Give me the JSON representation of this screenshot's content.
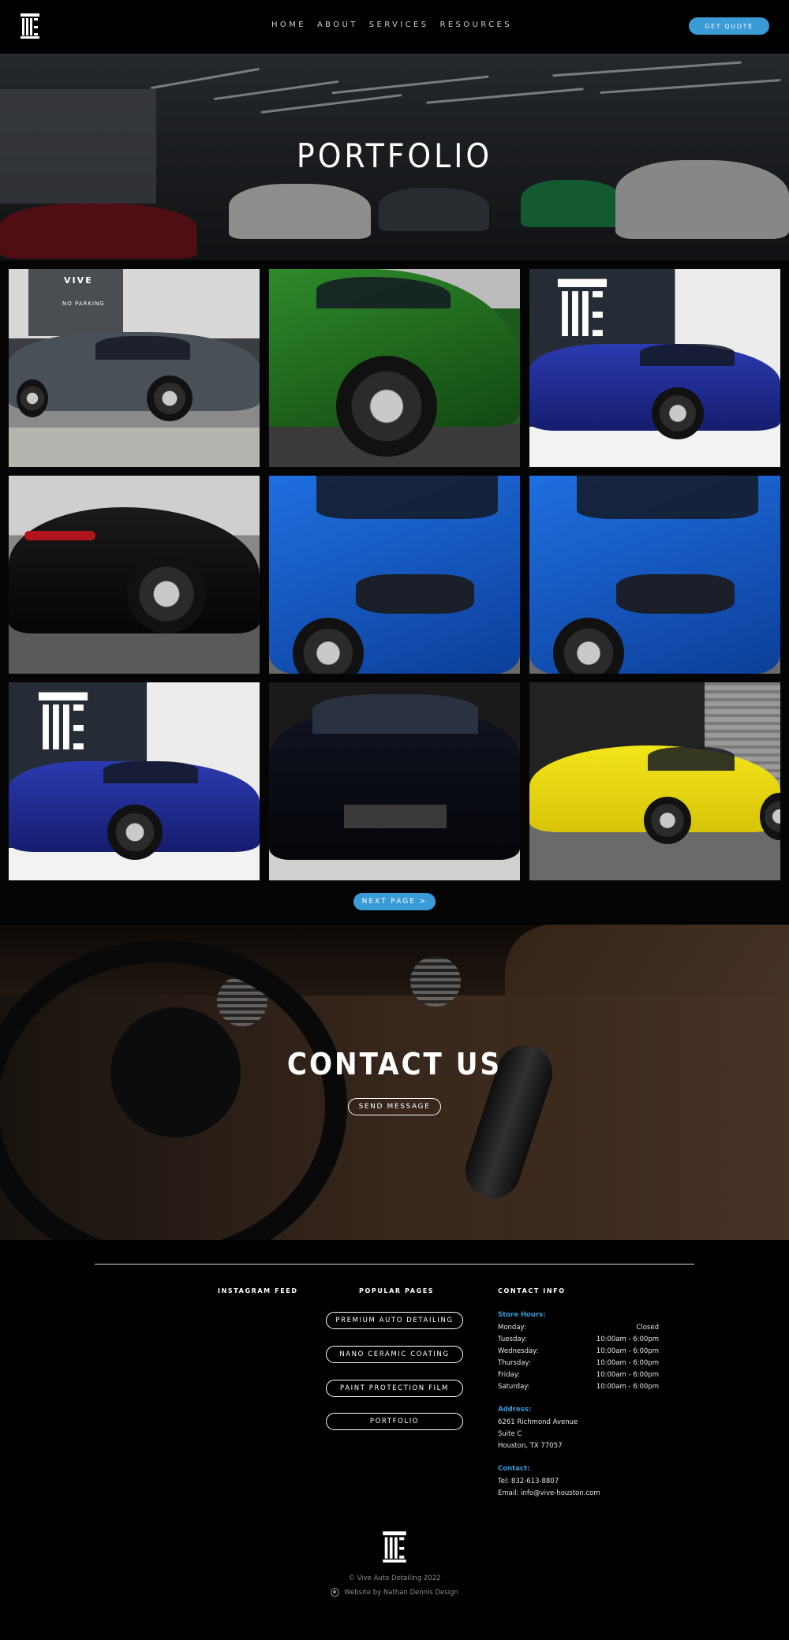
{
  "header": {
    "nav": [
      "HOME",
      "ABOUT",
      "SERVICES",
      "RESOURCES"
    ],
    "quote_label": "GET QUOTE"
  },
  "hero": {
    "title": "PORTFOLIO"
  },
  "gallery": {
    "tiles": [
      {
        "name": "gray-mercedes-coupe",
        "signage": "VIVE",
        "sign": "NO PARKING"
      },
      {
        "name": "green-audi-rs"
      },
      {
        "name": "blue-mustang-logo-wall",
        "signage": "VIVE"
      },
      {
        "name": "black-porsche-911"
      },
      {
        "name": "blue-toyota-4runner"
      },
      {
        "name": "blue-toyota-4runner-2"
      },
      {
        "name": "blue-mustang-front",
        "signage": "VIVE"
      },
      {
        "name": "black-mitsubishi-evo"
      },
      {
        "name": "yellow-porsche-cayman"
      }
    ],
    "next_label": "NEXT PAGE >"
  },
  "contact": {
    "title": "CONTACT US",
    "send_label": "SEND MESSAGE"
  },
  "footer": {
    "instagram_title": "INSTAGRAM FEED",
    "popular_title": "POPULAR PAGES",
    "contact_title": "CONTACT INFO",
    "popular_pages": [
      "PREMIUM AUTO DETAILING",
      "NANO CERAMIC COATING",
      "PAINT PROTECTION FILM",
      "PORTFOLIO"
    ],
    "store_hours_label": "Store Hours:",
    "hours": [
      {
        "day": "Monday:",
        "time": "Closed"
      },
      {
        "day": "Tuesday:",
        "time": "10:00am - 6:00pm"
      },
      {
        "day": "Wednesday:",
        "time": "10:00am - 6:00pm"
      },
      {
        "day": "Thursday:",
        "time": "10:00am - 6:00pm"
      },
      {
        "day": "Friday:",
        "time": "10:00am - 6:00pm"
      },
      {
        "day": "Saturday:",
        "time": "10:00am - 6:00pm"
      }
    ],
    "address_label": "Address:",
    "address": [
      "6261 Richmond Avenue",
      "Suite C",
      "Houston, TX 77057"
    ],
    "contact_label": "Contact:",
    "tel": "Tel: 832-613-8807",
    "email": "Email: info@vive-houston.com",
    "copyright": "© Vive Auto Detailing 2022",
    "credit": "Website by Nathan Dennis Design"
  },
  "colors": {
    "accent": "#3a9bd6",
    "background": "#000000"
  }
}
